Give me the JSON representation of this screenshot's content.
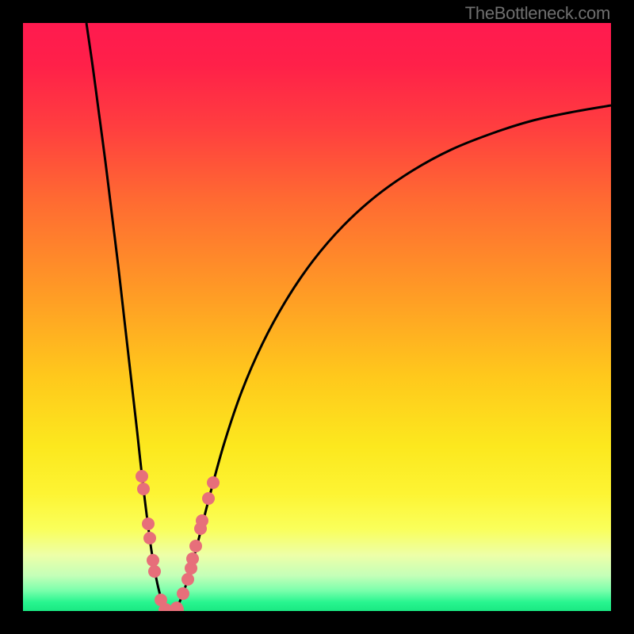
{
  "attribution": "TheBottleneck.com",
  "gradient_stops": [
    {
      "offset": 0.0,
      "color": "#ff1a4f"
    },
    {
      "offset": 0.07,
      "color": "#ff2049"
    },
    {
      "offset": 0.18,
      "color": "#ff3f3f"
    },
    {
      "offset": 0.3,
      "color": "#ff6a32"
    },
    {
      "offset": 0.45,
      "color": "#ff9826"
    },
    {
      "offset": 0.6,
      "color": "#ffc81c"
    },
    {
      "offset": 0.72,
      "color": "#fce81e"
    },
    {
      "offset": 0.8,
      "color": "#fdf433"
    },
    {
      "offset": 0.86,
      "color": "#faff5a"
    },
    {
      "offset": 0.905,
      "color": "#edffa8"
    },
    {
      "offset": 0.94,
      "color": "#c4ffb8"
    },
    {
      "offset": 0.965,
      "color": "#7bffac"
    },
    {
      "offset": 0.985,
      "color": "#28f58f"
    },
    {
      "offset": 1.0,
      "color": "#1ae882"
    }
  ],
  "chart_data": {
    "type": "line",
    "title": "",
    "xlabel": "",
    "ylabel": "",
    "x_range": [
      0,
      742
    ],
    "y_range_screen": [
      0,
      742
    ],
    "note": "Two curved branches descending to a minimum near x≈180 at y≈742 (bottom). y values are screen-space (0=top).",
    "left_branch": [
      {
        "x": 80,
        "y": 0
      },
      {
        "x": 88,
        "y": 55
      },
      {
        "x": 96,
        "y": 115
      },
      {
        "x": 104,
        "y": 175
      },
      {
        "x": 112,
        "y": 240
      },
      {
        "x": 120,
        "y": 305
      },
      {
        "x": 128,
        "y": 375
      },
      {
        "x": 136,
        "y": 445
      },
      {
        "x": 144,
        "y": 515
      },
      {
        "x": 150,
        "y": 570
      },
      {
        "x": 156,
        "y": 620
      },
      {
        "x": 162,
        "y": 665
      },
      {
        "x": 168,
        "y": 700
      },
      {
        "x": 174,
        "y": 725
      },
      {
        "x": 180,
        "y": 740
      },
      {
        "x": 186,
        "y": 742
      }
    ],
    "right_branch": [
      {
        "x": 186,
        "y": 742
      },
      {
        "x": 192,
        "y": 740
      },
      {
        "x": 200,
        "y": 725
      },
      {
        "x": 210,
        "y": 695
      },
      {
        "x": 222,
        "y": 650
      },
      {
        "x": 236,
        "y": 595
      },
      {
        "x": 254,
        "y": 530
      },
      {
        "x": 276,
        "y": 465
      },
      {
        "x": 302,
        "y": 405
      },
      {
        "x": 332,
        "y": 350
      },
      {
        "x": 366,
        "y": 300
      },
      {
        "x": 404,
        "y": 256
      },
      {
        "x": 446,
        "y": 218
      },
      {
        "x": 492,
        "y": 186
      },
      {
        "x": 540,
        "y": 160
      },
      {
        "x": 590,
        "y": 140
      },
      {
        "x": 640,
        "y": 124
      },
      {
        "x": 690,
        "y": 113
      },
      {
        "x": 742,
        "y": 104
      }
    ],
    "markers_left": [
      {
        "x": 150,
        "y": 572
      },
      {
        "x": 152,
        "y": 588
      },
      {
        "x": 158,
        "y": 632
      },
      {
        "x": 160,
        "y": 650
      },
      {
        "x": 164,
        "y": 678
      },
      {
        "x": 166,
        "y": 692
      },
      {
        "x": 174,
        "y": 728
      },
      {
        "x": 180,
        "y": 740
      }
    ],
    "markers_right": [
      {
        "x": 194,
        "y": 738
      },
      {
        "x": 202,
        "y": 720
      },
      {
        "x": 208,
        "y": 702
      },
      {
        "x": 212,
        "y": 688
      },
      {
        "x": 214,
        "y": 676
      },
      {
        "x": 218,
        "y": 660
      },
      {
        "x": 224,
        "y": 638
      },
      {
        "x": 226,
        "y": 628
      },
      {
        "x": 234,
        "y": 600
      },
      {
        "x": 240,
        "y": 580
      }
    ],
    "markers_bottom": [
      {
        "x": 178,
        "y": 741
      },
      {
        "x": 184,
        "y": 742
      },
      {
        "x": 190,
        "y": 742
      },
      {
        "x": 196,
        "y": 740
      }
    ],
    "marker_color": "#e76f7a",
    "curve_color": "#000000"
  }
}
